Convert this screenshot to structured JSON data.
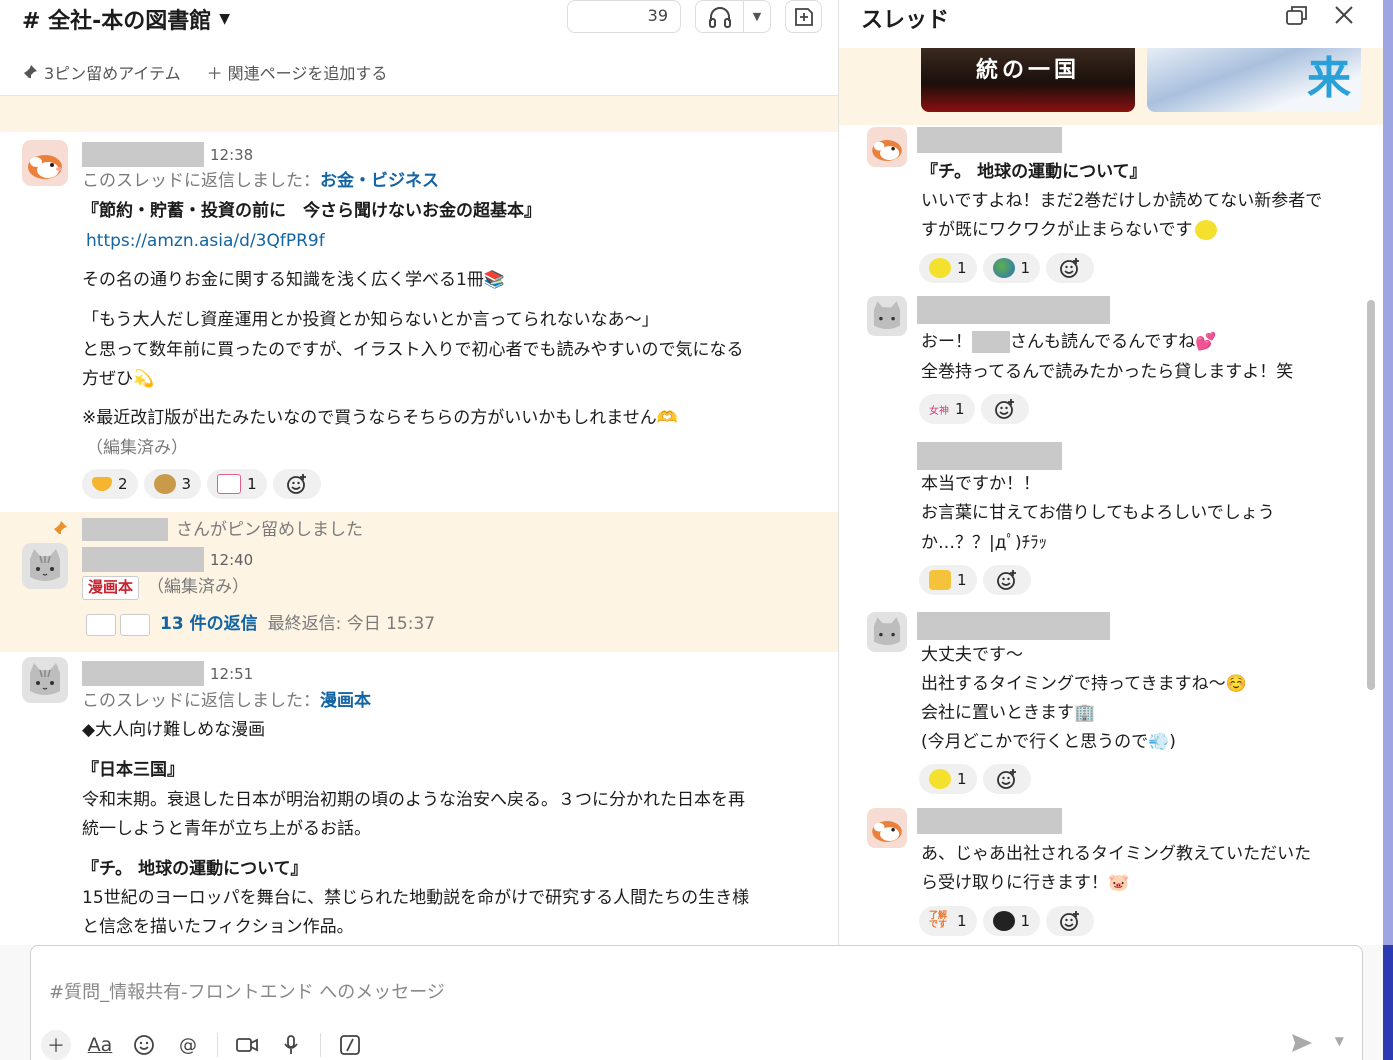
{
  "channel": {
    "title": "# 全社-本の図書館",
    "member_count": "39",
    "bookmarks": {
      "pinned": "3ピン留めアイテム",
      "add_page": "＋ 関連ページを追加する"
    }
  },
  "messages": [
    {
      "time": "12:38",
      "reply_prefix": "このスレッドに返信しました：",
      "reply_channel": "お金・ビジネス",
      "book_title": "『節約・貯蓄・投資の前に　今さら聞けないお金の超基本』",
      "url": "https://amzn.asia/d/3QfPR9f",
      "line1": "その名の通りお金に関する知識を浅く広く学べる1冊📚",
      "line2": "「もう大人だし資産運用とか投資とか知らないとか言ってられないなあ～」",
      "line3": "と思って数年前に買ったのですが、イラスト入りで初心者でも読みやすいので気になる",
      "line4": "方ぜひ💫",
      "line5": "※最近改訂版が出たみたいなので買うならそちらの方がいいかもしれません🫶",
      "edited": "（編集済み）",
      "reactions": [
        {
          "emoji": "heart-hands",
          "count": "2"
        },
        {
          "emoji": "money-bag",
          "count": "3"
        },
        {
          "emoji": "moneybag-text",
          "count": "1"
        }
      ]
    },
    {
      "pinned_by_suffix": "さんがピン留めしました",
      "time": "12:40",
      "tag": "漫画本",
      "edited": "（編集済み）",
      "replies": "13 件の返信",
      "last_reply": "最終返信: 今日 15:37"
    },
    {
      "time": "12:51",
      "reply_prefix": "このスレッドに返信しました：",
      "reply_channel": "漫画本",
      "line1": "◆大人向け難しめな漫画",
      "title1": "『日本三国』",
      "desc1a": "令和末期。衰退した日本が明治初期の頃のような治安へ戻る。３つに分かれた日本を再",
      "desc1b": "統一しようと青年が立ち上がるお話。",
      "title2": "『チ。 地球の運動について』",
      "desc2a": "15世紀のヨーロッパを舞台に、禁じられた地動説を命がけで研究する人間たちの生き様",
      "desc2b": "と信念を描いたフィクション作品。"
    }
  ],
  "thread": {
    "title": "スレッド",
    "book1_text": "統の一国",
    "book2_text": "来",
    "messages": [
      {
        "line1": "『チ。 地球の運動について』",
        "line2": "いいですよね！まだ2巻だけしか読めてない新参者で",
        "line3": "すが既にワクワクが止まらないです",
        "reactions": [
          {
            "emoji": "sparkle-face",
            "count": "1"
          },
          {
            "emoji": "earth",
            "count": "1"
          }
        ]
      },
      {
        "line1a": "おー！",
        "line1b": "さんも読んでるんですね💕",
        "line2": "全巻持ってるんで読みたかったら貸しますよ！笑",
        "reactions": [
          {
            "emoji": "goddess",
            "label": "女神",
            "count": "1"
          }
        ]
      },
      {
        "line1": "本当ですか！！",
        "line2": "お言葉に甘えてお借りしてもよろしいでしょう",
        "line3": "か…？？|дﾟ)ﾁﾗｯ",
        "reactions": [
          {
            "emoji": "thumbs-up",
            "count": "1"
          }
        ]
      },
      {
        "line1": "大丈夫です～",
        "line2": "出社するタイミングで持ってきますね～☺️",
        "line3": "会社に置いときます🏢",
        "line4": "(今月どこかで行くと思うので💨)",
        "reactions": [
          {
            "emoji": "sparkle-face",
            "count": "1"
          }
        ]
      },
      {
        "line1": "あ、じゃあ出社されるタイミング教えていただいた",
        "line2": "ら受け取りに行きます！🐷",
        "reactions": [
          {
            "emoji": "ryokai",
            "label": "了解です",
            "count": "1"
          },
          {
            "emoji": "dark-circle",
            "count": "1"
          }
        ]
      }
    ]
  },
  "composer": {
    "placeholder": "#質問_情報共有-フロントエンド へのメッセージ"
  }
}
